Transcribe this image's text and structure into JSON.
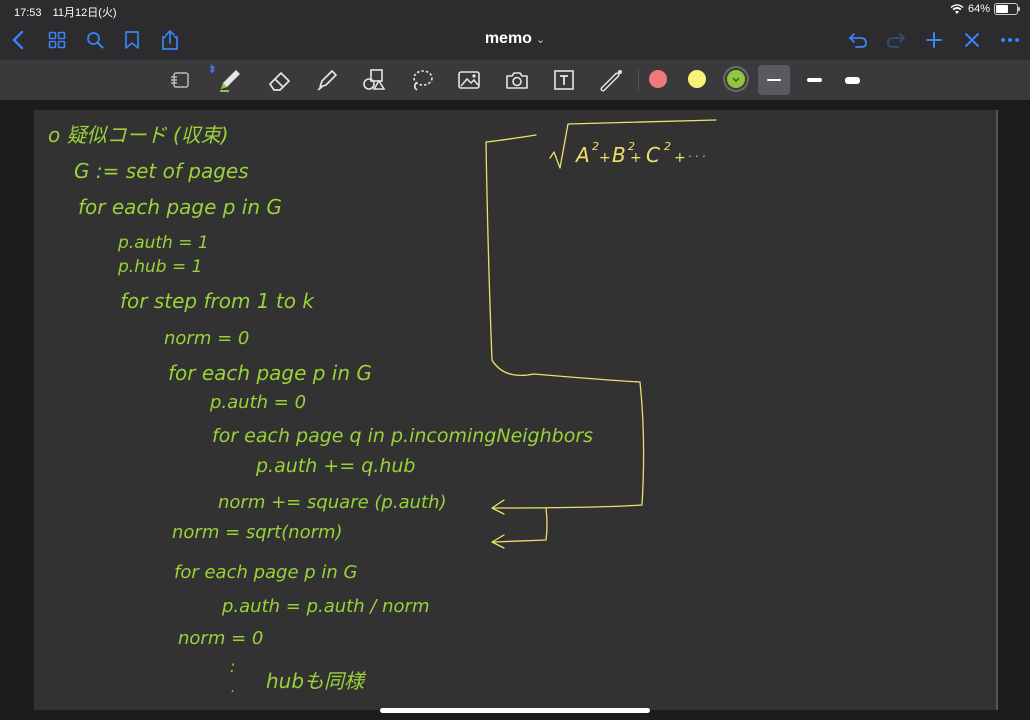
{
  "status_bar": {
    "time": "17:53",
    "date": "11月12日(火)",
    "battery": "64%",
    "battery_level": 0.64
  },
  "nav": {
    "title": "memo"
  },
  "colors": {
    "pen_green": "#8ec63f",
    "ink_yellow": "#ede06a",
    "swatch_red": "#f07a7a",
    "swatch_yellow": "#f7f37a",
    "swatch_green": "#8ec63f",
    "accent_blue": "#3a82f7"
  },
  "toolbar": {
    "tools": [
      "pen-icon",
      "eraser-icon",
      "highlighter-icon",
      "shapes-icon",
      "lasso-icon",
      "image-icon",
      "camera-icon",
      "text-box-icon",
      "laser-pointer-icon"
    ],
    "color_swatches": [
      "#f07a7a",
      "#f7f37a",
      "#8ec63f"
    ],
    "selected_color": "#8ec63f",
    "selected_stroke": 0
  },
  "note": {
    "lines": [
      "o 疑似コード (収束)",
      "G := set of pages",
      "for each page p in G",
      "p.auth = 1",
      "p.hub = 1",
      "for step from 1 to k",
      "norm = 0",
      "for each page p in G",
      "p.auth = 0",
      "for each page q in p.incomingNeighbors",
      "p.auth += q.hub",
      "norm += square (p.auth)",
      "norm = sqrt(norm)",
      "for each page p in G",
      "p.auth = p.auth / norm",
      "norm = 0",
      "hubも同様"
    ],
    "formula": {
      "A": "A",
      "B": "B",
      "C": "C",
      "exp": "2",
      "plus": "+",
      "dots": "· · ·"
    }
  }
}
